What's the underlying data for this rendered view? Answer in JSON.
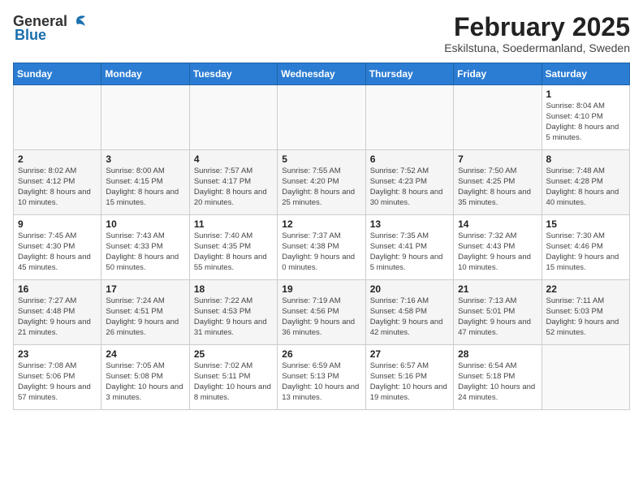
{
  "header": {
    "logo_general": "General",
    "logo_blue": "Blue",
    "month": "February 2025",
    "location": "Eskilstuna, Soedermanland, Sweden"
  },
  "days_of_week": [
    "Sunday",
    "Monday",
    "Tuesday",
    "Wednesday",
    "Thursday",
    "Friday",
    "Saturday"
  ],
  "weeks": [
    [
      {
        "day": "",
        "detail": ""
      },
      {
        "day": "",
        "detail": ""
      },
      {
        "day": "",
        "detail": ""
      },
      {
        "day": "",
        "detail": ""
      },
      {
        "day": "",
        "detail": ""
      },
      {
        "day": "",
        "detail": ""
      },
      {
        "day": "1",
        "detail": "Sunrise: 8:04 AM\nSunset: 4:10 PM\nDaylight: 8 hours and 5 minutes."
      }
    ],
    [
      {
        "day": "2",
        "detail": "Sunrise: 8:02 AM\nSunset: 4:12 PM\nDaylight: 8 hours and 10 minutes."
      },
      {
        "day": "3",
        "detail": "Sunrise: 8:00 AM\nSunset: 4:15 PM\nDaylight: 8 hours and 15 minutes."
      },
      {
        "day": "4",
        "detail": "Sunrise: 7:57 AM\nSunset: 4:17 PM\nDaylight: 8 hours and 20 minutes."
      },
      {
        "day": "5",
        "detail": "Sunrise: 7:55 AM\nSunset: 4:20 PM\nDaylight: 8 hours and 25 minutes."
      },
      {
        "day": "6",
        "detail": "Sunrise: 7:52 AM\nSunset: 4:23 PM\nDaylight: 8 hours and 30 minutes."
      },
      {
        "day": "7",
        "detail": "Sunrise: 7:50 AM\nSunset: 4:25 PM\nDaylight: 8 hours and 35 minutes."
      },
      {
        "day": "8",
        "detail": "Sunrise: 7:48 AM\nSunset: 4:28 PM\nDaylight: 8 hours and 40 minutes."
      }
    ],
    [
      {
        "day": "9",
        "detail": "Sunrise: 7:45 AM\nSunset: 4:30 PM\nDaylight: 8 hours and 45 minutes."
      },
      {
        "day": "10",
        "detail": "Sunrise: 7:43 AM\nSunset: 4:33 PM\nDaylight: 8 hours and 50 minutes."
      },
      {
        "day": "11",
        "detail": "Sunrise: 7:40 AM\nSunset: 4:35 PM\nDaylight: 8 hours and 55 minutes."
      },
      {
        "day": "12",
        "detail": "Sunrise: 7:37 AM\nSunset: 4:38 PM\nDaylight: 9 hours and 0 minutes."
      },
      {
        "day": "13",
        "detail": "Sunrise: 7:35 AM\nSunset: 4:41 PM\nDaylight: 9 hours and 5 minutes."
      },
      {
        "day": "14",
        "detail": "Sunrise: 7:32 AM\nSunset: 4:43 PM\nDaylight: 9 hours and 10 minutes."
      },
      {
        "day": "15",
        "detail": "Sunrise: 7:30 AM\nSunset: 4:46 PM\nDaylight: 9 hours and 15 minutes."
      }
    ],
    [
      {
        "day": "16",
        "detail": "Sunrise: 7:27 AM\nSunset: 4:48 PM\nDaylight: 9 hours and 21 minutes."
      },
      {
        "day": "17",
        "detail": "Sunrise: 7:24 AM\nSunset: 4:51 PM\nDaylight: 9 hours and 26 minutes."
      },
      {
        "day": "18",
        "detail": "Sunrise: 7:22 AM\nSunset: 4:53 PM\nDaylight: 9 hours and 31 minutes."
      },
      {
        "day": "19",
        "detail": "Sunrise: 7:19 AM\nSunset: 4:56 PM\nDaylight: 9 hours and 36 minutes."
      },
      {
        "day": "20",
        "detail": "Sunrise: 7:16 AM\nSunset: 4:58 PM\nDaylight: 9 hours and 42 minutes."
      },
      {
        "day": "21",
        "detail": "Sunrise: 7:13 AM\nSunset: 5:01 PM\nDaylight: 9 hours and 47 minutes."
      },
      {
        "day": "22",
        "detail": "Sunrise: 7:11 AM\nSunset: 5:03 PM\nDaylight: 9 hours and 52 minutes."
      }
    ],
    [
      {
        "day": "23",
        "detail": "Sunrise: 7:08 AM\nSunset: 5:06 PM\nDaylight: 9 hours and 57 minutes."
      },
      {
        "day": "24",
        "detail": "Sunrise: 7:05 AM\nSunset: 5:08 PM\nDaylight: 10 hours and 3 minutes."
      },
      {
        "day": "25",
        "detail": "Sunrise: 7:02 AM\nSunset: 5:11 PM\nDaylight: 10 hours and 8 minutes."
      },
      {
        "day": "26",
        "detail": "Sunrise: 6:59 AM\nSunset: 5:13 PM\nDaylight: 10 hours and 13 minutes."
      },
      {
        "day": "27",
        "detail": "Sunrise: 6:57 AM\nSunset: 5:16 PM\nDaylight: 10 hours and 19 minutes."
      },
      {
        "day": "28",
        "detail": "Sunrise: 6:54 AM\nSunset: 5:18 PM\nDaylight: 10 hours and 24 minutes."
      },
      {
        "day": "",
        "detail": ""
      }
    ]
  ]
}
